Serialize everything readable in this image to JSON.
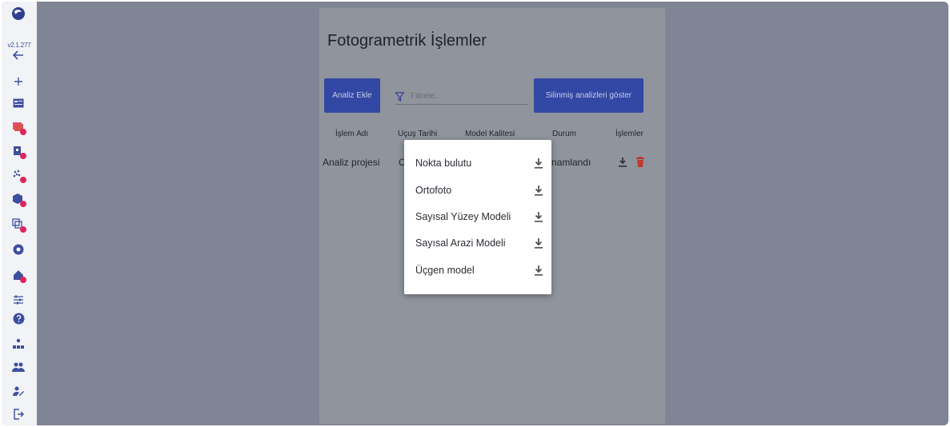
{
  "app": {
    "version": "v2.1.277"
  },
  "sidebar": {
    "items": [
      {
        "name": "logo-icon"
      },
      {
        "name": "back-icon"
      },
      {
        "name": "plus-icon"
      },
      {
        "name": "id-card-icon"
      },
      {
        "name": "photo-stack-icon"
      },
      {
        "name": "map-marker-icon"
      },
      {
        "name": "scatter-points-icon"
      },
      {
        "name": "cube-icon"
      },
      {
        "name": "layers-icon"
      },
      {
        "name": "shutter-icon"
      },
      {
        "name": "home-settings-icon"
      },
      {
        "name": "sliders-icon"
      },
      {
        "name": "help-icon"
      },
      {
        "name": "org-chart-icon"
      },
      {
        "name": "users-icon"
      },
      {
        "name": "user-edit-icon"
      },
      {
        "name": "logout-icon"
      }
    ]
  },
  "page": {
    "title": "Fotogrametrik İşlemler",
    "add_button": "Analiz Ekle",
    "filter_placeholder": "Filtrele...",
    "show_deleted_button": "Silinmiş analizleri göster"
  },
  "table": {
    "headers": [
      "İşlem Adı",
      "Uçuş Tarihi",
      "Model Kalitesi",
      "Durum",
      "İşlemler"
    ],
    "rows": [
      {
        "name": "Analiz projesi",
        "flight_date_partial": "C",
        "status_partial": "namlandı"
      }
    ]
  },
  "download_menu": {
    "items": [
      {
        "label": "Nokta bulutu",
        "icon": "download-icon"
      },
      {
        "label": "Ortofoto",
        "icon": "download-icon"
      },
      {
        "label": "Sayısal Yüzey Modeli",
        "icon": "download-icon"
      },
      {
        "label": "Sayısal Arazi Modeli",
        "icon": "download-icon"
      },
      {
        "label": "Üçgen model",
        "icon": "download-icon"
      }
    ]
  },
  "colors": {
    "primary": "#3347a4",
    "sidebar_icon": "#3d4f9f",
    "badge": "#e0245e",
    "delete": "#c0392b",
    "overlay": "#7f8594"
  }
}
